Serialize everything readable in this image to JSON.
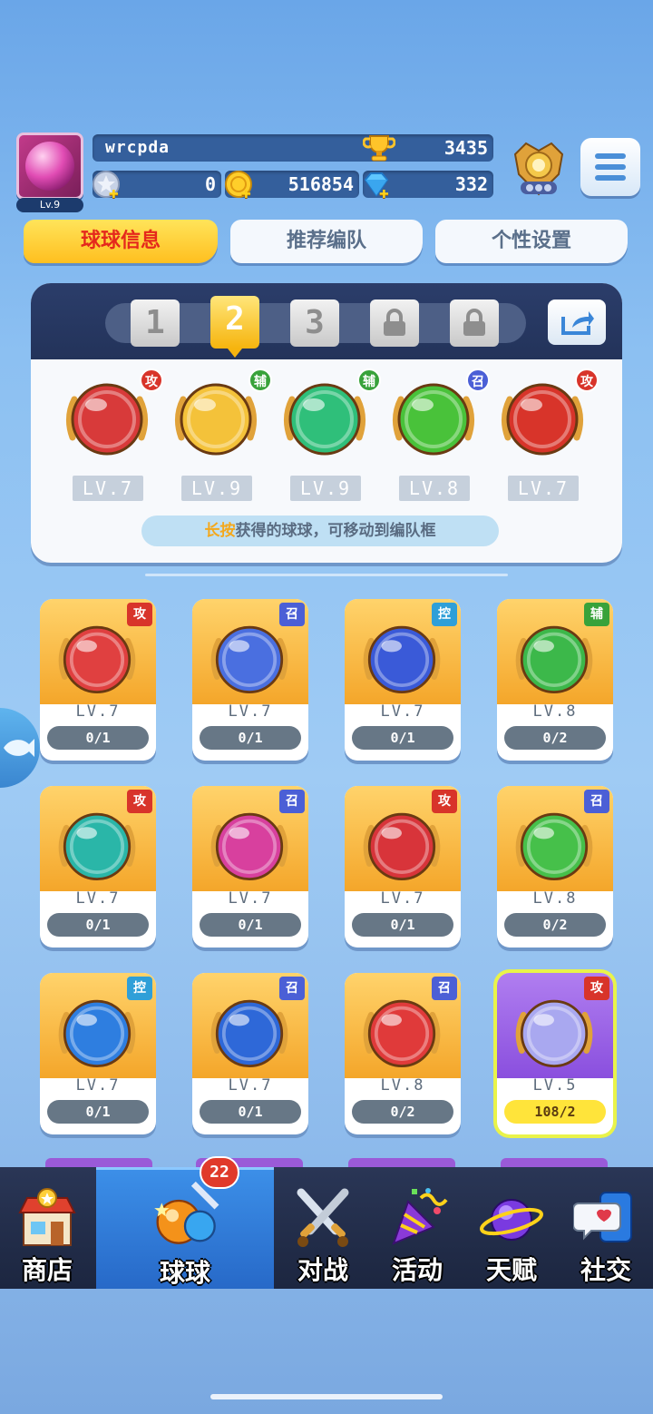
{
  "player": {
    "level_label": "Lv.9",
    "name": "wrcpda",
    "trophies": "3435",
    "stars": "0",
    "coins": "516854",
    "gems": "332"
  },
  "tabs": [
    {
      "label": "球球信息",
      "active": true
    },
    {
      "label": "推荐编队",
      "active": false
    },
    {
      "label": "个性设置",
      "active": false
    }
  ],
  "team": {
    "slots": [
      "1",
      "2",
      "3"
    ],
    "active_slot": "2",
    "balls": [
      {
        "tag": "攻",
        "level": "LV.7",
        "color": "#d83a3a"
      },
      {
        "tag": "辅",
        "level": "LV.9",
        "color": "#f4c23a"
      },
      {
        "tag": "辅",
        "level": "LV.9",
        "color": "#2fbf7a"
      },
      {
        "tag": "召",
        "level": "LV.8",
        "color": "#49c23a"
      },
      {
        "tag": "攻",
        "level": "LV.7",
        "color": "#d8342a"
      }
    ],
    "hint_emphasis": "长按",
    "hint_rest": "获得的球球，可移动到编队框"
  },
  "cards": [
    {
      "tag": "攻",
      "level": "LV.7",
      "count": "0/1",
      "color": "#e04040"
    },
    {
      "tag": "召",
      "level": "LV.7",
      "count": "0/1",
      "color": "#4a6fe0"
    },
    {
      "tag": "控",
      "level": "LV.7",
      "count": "0/1",
      "color": "#3a5ad8"
    },
    {
      "tag": "辅",
      "level": "LV.8",
      "count": "0/2",
      "color": "#3cb84a"
    },
    {
      "tag": "攻",
      "level": "LV.7",
      "count": "0/1",
      "color": "#2ab6a8"
    },
    {
      "tag": "召",
      "level": "LV.7",
      "count": "0/1",
      "color": "#d8409e"
    },
    {
      "tag": "攻",
      "level": "LV.7",
      "count": "0/1",
      "color": "#d8343a"
    },
    {
      "tag": "召",
      "level": "LV.8",
      "count": "0/2",
      "color": "#46c04a"
    },
    {
      "tag": "控",
      "level": "LV.7",
      "count": "0/1",
      "color": "#2e7ee0"
    },
    {
      "tag": "召",
      "level": "LV.7",
      "count": "0/1",
      "color": "#2e68d8"
    },
    {
      "tag": "召",
      "level": "LV.8",
      "count": "0/2",
      "color": "#e03a3a"
    },
    {
      "tag": "攻",
      "level": "LV.5",
      "count": "108/2",
      "color": "#a9a8f0"
    }
  ],
  "nav": {
    "badge": "22",
    "items": [
      {
        "label": "商店"
      },
      {
        "label": "球球"
      },
      {
        "label": "对战"
      },
      {
        "label": "活动"
      },
      {
        "label": "天赋"
      },
      {
        "label": "社交"
      }
    ]
  }
}
